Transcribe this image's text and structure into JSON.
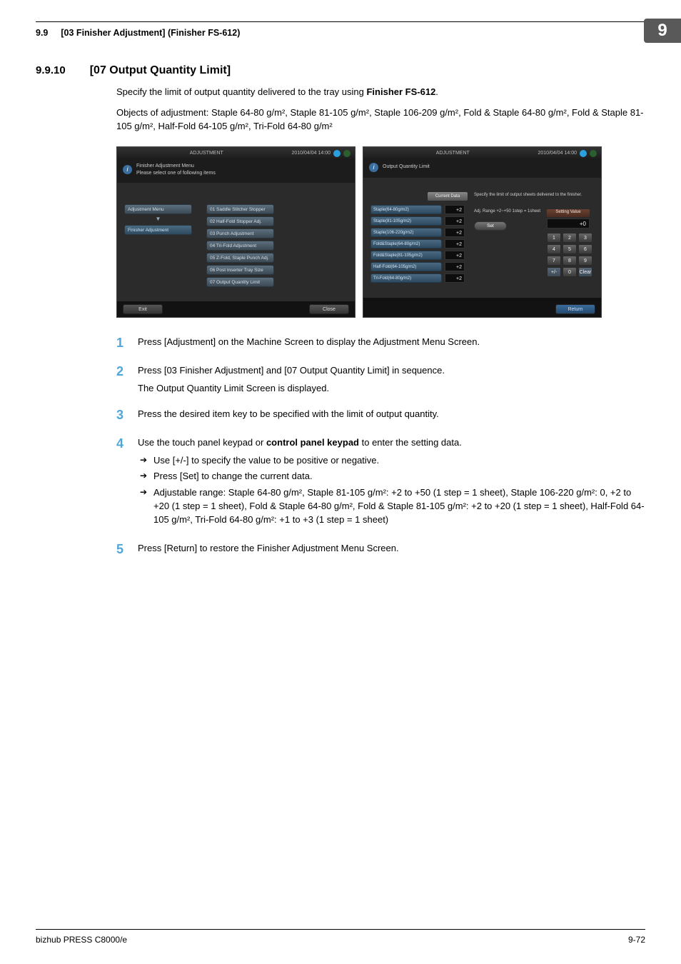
{
  "header": {
    "section": "9.9",
    "title": "[03 Finisher Adjustment] (Finisher FS-612)",
    "chapter": "9"
  },
  "subsection": {
    "number": "9.9.10",
    "title": "[07 Output Quantity Limit]"
  },
  "intro": {
    "p1_a": "Specify the limit of output quantity delivered to the tray using ",
    "p1_b": "Finisher FS-612",
    "p1_c": ".",
    "p2": "Objects of adjustment: Staple 64-80 g/m², Staple 81-105 g/m², Staple 106-209 g/m², Fold & Staple 64-80 g/m², Fold & Staple 81-105 g/m², Half-Fold 64-105 g/m², Tri-Fold 64-80 g/m²"
  },
  "screen_left": {
    "top_tab": "ADJUSTMENT",
    "date": "2010/04/04 14:00",
    "header_l1": "Finisher Adjustment Menu",
    "header_l2": "Please select one of following items",
    "left_items": [
      "Adjustment Menu",
      "Finisher Adjustment"
    ],
    "right_items": [
      "01 Saddle Stitcher Stopper",
      "02 Half-Fold Stopper Adj.",
      "03 Punch Adjustment",
      "04 Tri-Fold Adjustment",
      "05 Z-Fold, Staple Punch Adj.",
      "06 Post Inserter Tray Size",
      "07 Output Quantity Limit"
    ],
    "exit": "Exit",
    "close": "Close"
  },
  "screen_right": {
    "top_tab": "ADJUSTMENT",
    "date": "2010/04/04 14:00",
    "header": "Output Quantity Limit",
    "current": "Current Data",
    "desc1": "Specify the limit of output sheets delivered to the finisher.",
    "desc2": "Adj. Range +2~+50 1step = 1sheet",
    "setbtn": "Set",
    "svlabel": "Setting Value",
    "svval": "+0",
    "params": [
      {
        "label": "Staple(64-80g/m2)",
        "val": "+2"
      },
      {
        "label": "Staple(81-105g/m2)",
        "val": "+2"
      },
      {
        "label": "Staple(106-220g/m2)",
        "val": "+2"
      },
      {
        "label": "Fold&Staple(64-80g/m2)",
        "val": "+2"
      },
      {
        "label": "Fold&Staple(81-105g/m2)",
        "val": "+2"
      },
      {
        "label": "Half-Fold(64-105g/m2)",
        "val": "+2"
      },
      {
        "label": "Tri-Fold(64-80g/m2)",
        "val": "+2"
      }
    ],
    "keys": [
      "1",
      "2",
      "3",
      "4",
      "5",
      "6",
      "7",
      "8",
      "9",
      "+/-",
      "0",
      "Clear"
    ],
    "return": "Return"
  },
  "steps": {
    "s1": "Press [Adjustment] on the Machine Screen to display the Adjustment Menu Screen.",
    "s2a": "Press [03 Finisher Adjustment] and [07 Output Quantity Limit] in sequence.",
    "s2b": "The Output Quantity Limit Screen is displayed.",
    "s3": "Press the desired item key to be specified with the limit of output quantity.",
    "s4_a": "Use the touch panel keypad or ",
    "s4_b": "control panel keypad",
    "s4_c": " to enter the setting data.",
    "s4_bullets": [
      "Use [+/-] to specify the value to be positive or negative.",
      "Press [Set] to change the current data.",
      "Adjustable range: Staple 64-80 g/m², Staple 81-105 g/m²: +2 to +50 (1 step = 1 sheet), Staple 106-220 g/m²: 0, +2 to +20 (1 step = 1 sheet), Fold & Staple 64-80 g/m², Fold & Staple 81-105 g/m²: +2 to +20 (1 step = 1 sheet), Half-Fold 64-105 g/m², Tri-Fold 64-80 g/m²: +1 to +3 (1 step = 1 sheet)"
    ],
    "s5": "Press [Return] to restore the Finisher Adjustment Menu Screen."
  },
  "footer": {
    "product": "bizhub PRESS C8000/e",
    "page": "9-72"
  }
}
